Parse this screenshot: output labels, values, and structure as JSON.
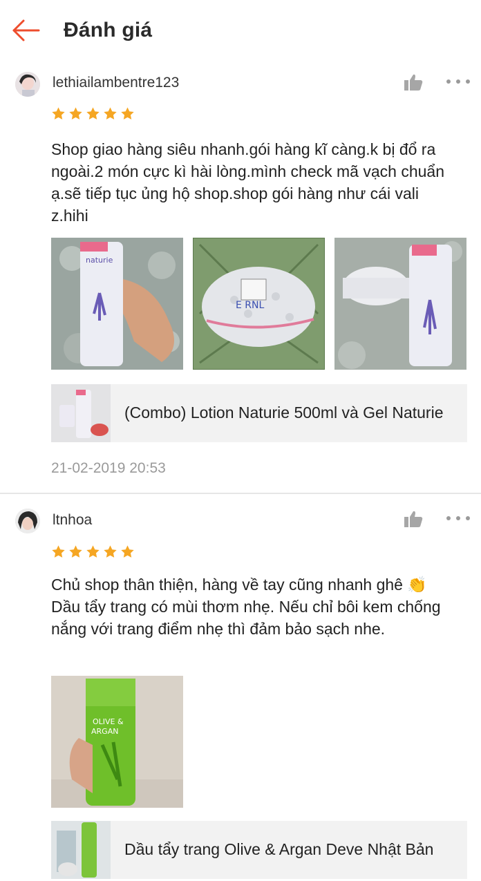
{
  "header": {
    "title": "Đánh giá",
    "back_icon": "arrow-left-icon",
    "accent_color": "#ee4d2d"
  },
  "reviews": [
    {
      "username": "lethiailambentre123",
      "rating": 5,
      "comment": "Shop giao hàng siêu nhanh.gói hàng kĩ càng.k bị đổ ra ngoài.2 món cực kì hài lòng.mình check mã vạch chuẩn ạ.sẽ tiếp tục ủng hộ shop.shop gói hàng như cái vali z.hihi",
      "photos": [
        "lotion-bottle-in-hand",
        "bubble-wrapped-package",
        "lotion-and-gel-jar"
      ],
      "product": {
        "name": "(Combo) Lotion Naturie 500ml và Gel Naturie"
      },
      "date": "21-02-2019 20:53"
    },
    {
      "username": "ltnhoa",
      "rating": 5,
      "comment": "Chủ shop thân thiện, hàng về tay cũng nhanh ghê 👏 Dầu tẩy trang có mùi thơm nhẹ. Nếu chỉ bôi kem chống nắng với trang điểm nhẹ thì đảm bảo sạch nhe.",
      "photos": [
        "green-cleansing-oil-bottle"
      ],
      "product": {
        "name": "Dầu tẩy trang Olive & Argan Deve Nhật Bản"
      }
    }
  ],
  "colors": {
    "star": "#f5a623",
    "like_icon": "#a6a6a6",
    "date_text": "#9a9a9a",
    "product_bg": "#f2f2f2"
  }
}
